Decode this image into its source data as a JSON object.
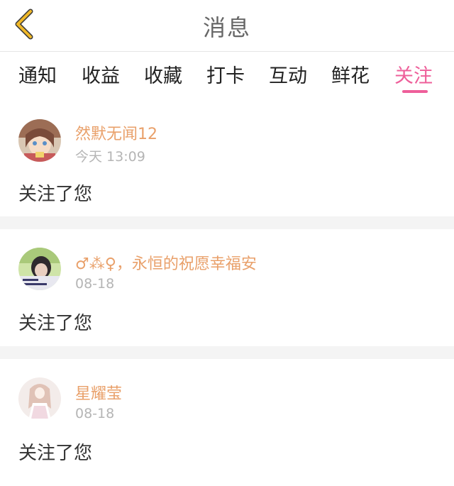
{
  "header": {
    "title": "消息",
    "back_icon": "chevron-left-icon"
  },
  "tabs": [
    {
      "label": "通知",
      "active": false
    },
    {
      "label": "收益",
      "active": false
    },
    {
      "label": "收藏",
      "active": false
    },
    {
      "label": "打卡",
      "active": false
    },
    {
      "label": "互动",
      "active": false
    },
    {
      "label": "鲜花",
      "active": false
    },
    {
      "label": "关注",
      "active": true
    }
  ],
  "colors": {
    "accent": "#ee5f9a",
    "username": "#e9a06a",
    "back_icon": "#f0b828",
    "timestamp": "#b5b5b5",
    "separator": "#f4f4f4"
  },
  "items": [
    {
      "username": "然默无闻12",
      "time": "今天 13:09",
      "message": "关注了您"
    },
    {
      "username": "♂⁂♀，永恒的祝愿幸福安",
      "time": "08-18",
      "message": "关注了您"
    },
    {
      "username": "星耀莹",
      "time": "08-18",
      "message": "关注了您"
    }
  ]
}
